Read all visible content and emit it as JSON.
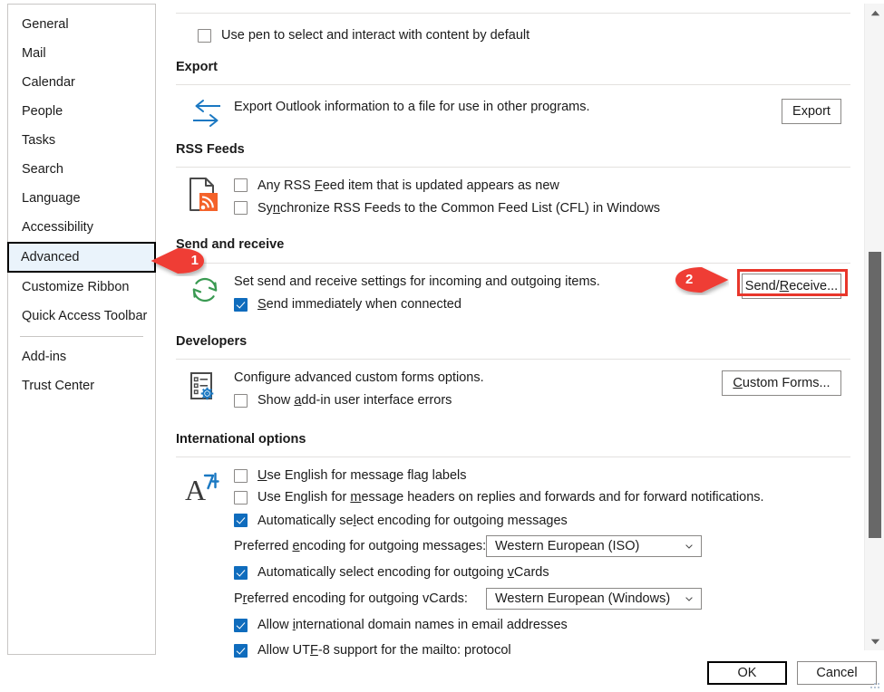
{
  "sidebar": {
    "items": [
      {
        "label": "General",
        "selected": false,
        "sep_after": false
      },
      {
        "label": "Mail",
        "selected": false,
        "sep_after": false
      },
      {
        "label": "Calendar",
        "selected": false,
        "sep_after": false
      },
      {
        "label": "People",
        "selected": false,
        "sep_after": false
      },
      {
        "label": "Tasks",
        "selected": false,
        "sep_after": false
      },
      {
        "label": "Search",
        "selected": false,
        "sep_after": false
      },
      {
        "label": "Language",
        "selected": false,
        "sep_after": false
      },
      {
        "label": "Accessibility",
        "selected": false,
        "sep_after": false
      },
      {
        "label": "Advanced",
        "selected": true,
        "sep_after": false
      },
      {
        "label": "Customize Ribbon",
        "selected": false,
        "sep_after": false
      },
      {
        "label": "Quick Access Toolbar",
        "selected": false,
        "sep_after": true
      },
      {
        "label": "Add-ins",
        "selected": false,
        "sep_after": false
      },
      {
        "label": "Trust Center",
        "selected": false,
        "sep_after": false
      }
    ]
  },
  "main": {
    "pen_option": {
      "label": "Use pen to select and interact with content by default",
      "checked": false
    },
    "export": {
      "heading": "Export",
      "description": "Export Outlook information to a file for use in other programs.",
      "button_label": "Export",
      "icon": "export-arrows-icon"
    },
    "rss": {
      "heading": "RSS Feeds",
      "icon": "rss-document-icon",
      "options": [
        {
          "label_pre": "Any RSS ",
          "accel": "F",
          "label_post": "eed item that is updated appears as new",
          "checked": false
        },
        {
          "label_pre": "Sy",
          "accel": "n",
          "label_post": "chronize RSS Feeds to the Common Feed List (CFL) in Windows",
          "checked": false
        }
      ]
    },
    "send_receive": {
      "heading": "Send and receive",
      "icon": "sync-circular-arrows-icon",
      "description": "Set send and receive settings for incoming and outgoing items.",
      "button_label": "Send/Receive...",
      "button_accel": "R",
      "option": {
        "label_pre": "",
        "accel": "S",
        "label_post": "end immediately when connected",
        "checked": true
      }
    },
    "developers": {
      "heading": "Developers",
      "icon": "custom-forms-gear-icon",
      "description": "Configure advanced custom forms options.",
      "button_label": "Custom Forms...",
      "button_accel": "C",
      "option": {
        "label_pre": "Show ",
        "accel": "a",
        "label_post": "dd-in user interface errors",
        "checked": false
      }
    },
    "international": {
      "heading": "International options",
      "icon": "language-a-icon",
      "options": [
        {
          "label_pre": "",
          "accel": "U",
          "label_post": "se English for message flag labels",
          "checked": false
        },
        {
          "label_pre": "Use English for ",
          "accel": "m",
          "label_post": "essage headers on replies and forwards and for forward notifications.",
          "checked": false
        },
        {
          "label_pre": "Automatically se",
          "accel": "l",
          "label_post": "ect encoding for outgoing messages",
          "checked": true
        }
      ],
      "encoding_messages": {
        "label_pre": "Preferred ",
        "accel": "e",
        "label_post": "ncoding for outgoing messages:",
        "value": "Western European (ISO)"
      },
      "vcards_checkbox": {
        "label_pre": "Automatically select encoding for outgoing ",
        "accel": "v",
        "label_post": "Cards",
        "checked": true
      },
      "encoding_vcards": {
        "label_pre": "P",
        "accel": "r",
        "label_post": "eferred encoding for outgoing vCards:",
        "value": "Western European (Windows)"
      },
      "idn_checkbox": {
        "label_pre": "Allow ",
        "accel": "i",
        "label_post": "nternational domain names in email addresses",
        "checked": true
      },
      "utf8_checkbox": {
        "label_pre": "Allow UT",
        "accel": "F",
        "label_post": "-8 support for the mailto: protocol",
        "checked": true
      }
    }
  },
  "footer": {
    "ok_label": "OK",
    "cancel_label": "Cancel"
  },
  "annotations": {
    "markers": [
      {
        "number": "1",
        "target": "sidebar-item-advanced"
      },
      {
        "number": "2",
        "target": "send-receive-button"
      }
    ],
    "highlight_color": "#e8362b"
  },
  "scrollbar": {
    "up_icon": "scroll-up-arrow-icon",
    "down_icon": "scroll-down-arrow-icon",
    "thumb": "scroll-thumb"
  }
}
